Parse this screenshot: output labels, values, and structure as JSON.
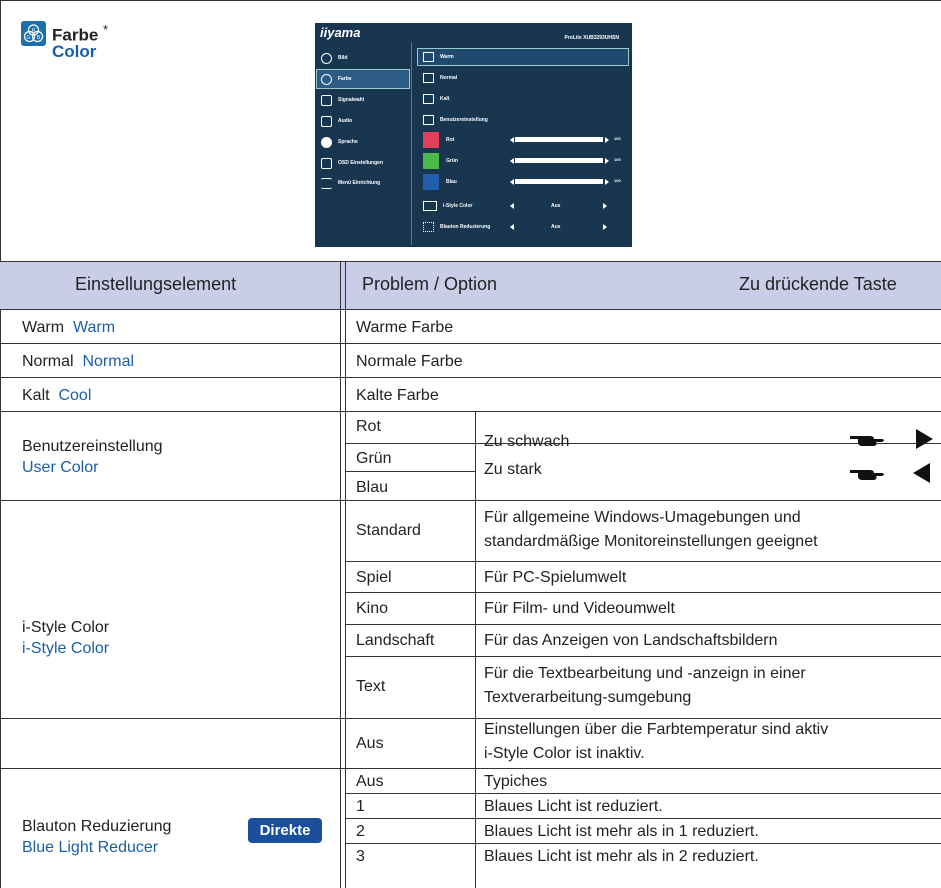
{
  "header": {
    "title": "Farbe",
    "asterisk": "*",
    "subtitle": "Color",
    "icon_letters": [
      "R",
      "G",
      "B"
    ]
  },
  "osd": {
    "logo": "iiyama",
    "model": "ProLite XUB3293UHSN",
    "side_menu": [
      {
        "label": "Bild",
        "icon": "brightness-icon"
      },
      {
        "label": "Farbe",
        "icon": "rgb-icon"
      },
      {
        "label": "Signalwahl",
        "icon": "input-icon"
      },
      {
        "label": "Audio",
        "icon": "speaker-icon"
      },
      {
        "label": "Sprache",
        "icon": "globe-icon"
      },
      {
        "label": "OSD Einstellungen",
        "icon": "osd-icon"
      },
      {
        "label": "Menü Einrichtung",
        "icon": "sliders-icon"
      }
    ],
    "items": [
      {
        "label": "Warm"
      },
      {
        "label": "Normal"
      },
      {
        "label": "Kalt"
      },
      {
        "label": "Benutzereinstellung"
      },
      {
        "label": "Rot",
        "value": "100",
        "level": 1.0,
        "swatch": "#e0405a"
      },
      {
        "label": "Grün",
        "value": "100",
        "level": 1.0,
        "swatch": "#4cb848"
      },
      {
        "label": "Blau",
        "value": "100",
        "level": 1.0,
        "swatch": "#1f5fae"
      },
      {
        "label": "i-Style Color",
        "value": "Aus"
      },
      {
        "label": "Blauton Reduzierung",
        "value": "Aus"
      }
    ]
  },
  "table": {
    "headers": {
      "col1": "Einstellungselement",
      "col2": "Problem / Option",
      "col3": "Zu drückende Taste"
    },
    "rows": {
      "warm": {
        "de": "Warm",
        "en": "Warm",
        "desc": "Warme Farbe"
      },
      "normal": {
        "de": "Normal",
        "en": "Normal",
        "desc": "Normale Farbe"
      },
      "cool": {
        "de": "Kalt",
        "en": "Cool",
        "desc": "Kalte Farbe"
      },
      "user": {
        "de": "Benutzereinstellung",
        "en": "User Color",
        "options": [
          "Rot",
          "Grün",
          "Blau"
        ],
        "weak": "Zu schwach",
        "strong": "Zu stark"
      },
      "istyle": {
        "de": "i-Style Color",
        "en": "i-Style Color",
        "options": [
          {
            "name": "Standard",
            "line1": "Für allgemeine Windows-Umagebungen und",
            "line2": "standardmäßige Monitoreinstellungen geeignet"
          },
          {
            "name": "Spiel",
            "line1": "Für PC-Spielumwelt"
          },
          {
            "name": "Kino",
            "line1": "Für Film- und Videoumwelt"
          },
          {
            "name": "Landschaft",
            "line1": "Für das Anzeigen von Landschaftsbildern"
          },
          {
            "name": "Text",
            "line1": "Für die Textbearbeitung und -anzeign in einer",
            "line2": "Textverarbeitung-sumgebung"
          },
          {
            "name": "Aus",
            "line1": "Einstellungen über die Farbtemperatur sind aktiv",
            "line2": "i-Style Color ist inaktiv."
          }
        ]
      },
      "bluelight": {
        "de": "Blauton Reduzierung",
        "en": "Blue Light Reducer",
        "badge": "Direkte",
        "options": [
          {
            "name": "Aus",
            "desc": "Typiches"
          },
          {
            "name": "1",
            "desc": "Blaues Licht ist reduziert."
          },
          {
            "name": "2",
            "desc": "Blaues Licht ist mehr als in 1 reduziert."
          },
          {
            "name": "3",
            "desc": "Blaues Licht ist mehr als in 2 reduziert."
          }
        ]
      }
    }
  },
  "colors": {
    "accent_blue": "#1a5ea8",
    "header_bg": "#c9cde8",
    "osd_bg": "#183650"
  }
}
